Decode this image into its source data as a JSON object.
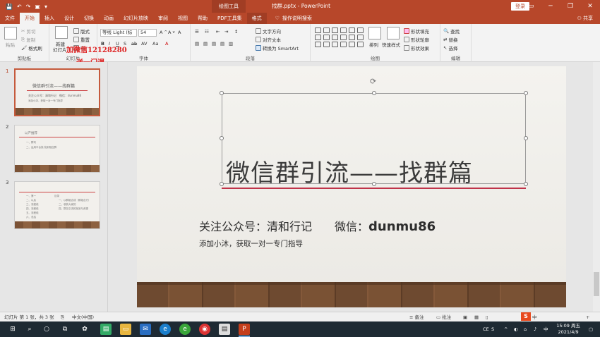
{
  "titlebar": {
    "tool_tab": "绘图工具",
    "doc_title": "找群.pptx - PowerPoint",
    "login": "登录",
    "qat": [
      "💾",
      "↶",
      "↷",
      "▣",
      "▾"
    ]
  },
  "tabs": [
    "文件",
    "开始",
    "插入",
    "设计",
    "切换",
    "动画",
    "幻灯片放映",
    "审阅",
    "视图",
    "帮助",
    "PDF工具集",
    "格式"
  ],
  "tell_me": "操作说明搜索",
  "share": "共享",
  "ribbon": {
    "clipboard": {
      "paste": "粘贴",
      "cut": "剪切",
      "copy": "复制",
      "format_painter": "格式刷",
      "label": "剪贴板"
    },
    "slides": {
      "new_slide": "新建",
      "new_slide2": "幻灯片",
      "layout": "版式",
      "reset": "重置",
      "section": "节",
      "label": "幻灯片"
    },
    "font": {
      "name": "等线 Light (标",
      "size": "54",
      "label": "字体"
    },
    "paragraph": {
      "text_direction": "文字方向",
      "align_text": "对齐文本",
      "smartart": "转换为 SmartArt",
      "label": "段落"
    },
    "drawing": {
      "arrange": "排列",
      "quick_styles": "快速样式",
      "fill": "形状填充",
      "outline": "形状轮廓",
      "effects": "形状效果",
      "label": "绘图"
    },
    "editing": {
      "find": "查找",
      "replace": "替换",
      "select": "选择",
      "label": "编辑"
    }
  },
  "watermark": {
    "line1": "加微信12128280",
    "line2": "送一门课"
  },
  "thumbnails": [
    {
      "num": "1",
      "title": "微信群引流——找群篇",
      "sub": "关注公众号：清和行记　微信：dunmu86",
      "note": "添加小沐，获取一对一专门指导"
    },
    {
      "num": "2",
      "title": "以产推荐",
      "items": [
        "一、群列",
        "二、运用平台找·找到相应群"
      ]
    },
    {
      "num": "3",
      "left": [
        "一、第一",
        "二、以后",
        "三、流程线",
        "四、流程线",
        "五、流程线",
        "六、总结"
      ],
      "right": [
        "目录",
        "一、以群组合成（群组合方）",
        "二、收获大家的",
        "四、群名引流的找到与资源"
      ]
    }
  ],
  "slide": {
    "title": "微信群引流——找群篇",
    "subtitle_label": "关注公众号：清和行记　　微信：",
    "subtitle_wechat": "dunmu86",
    "note": "添加小沐，获取一对一专门指导"
  },
  "status": {
    "slide_count": "幻灯片 第 1 张，共 3 张",
    "language": "中文(中国)",
    "notes": "备注",
    "comments": "批注",
    "ime": "中"
  },
  "taskbar": {
    "time": "15:09 周五",
    "date": "2021/4/9",
    "tray_text": "CE"
  }
}
